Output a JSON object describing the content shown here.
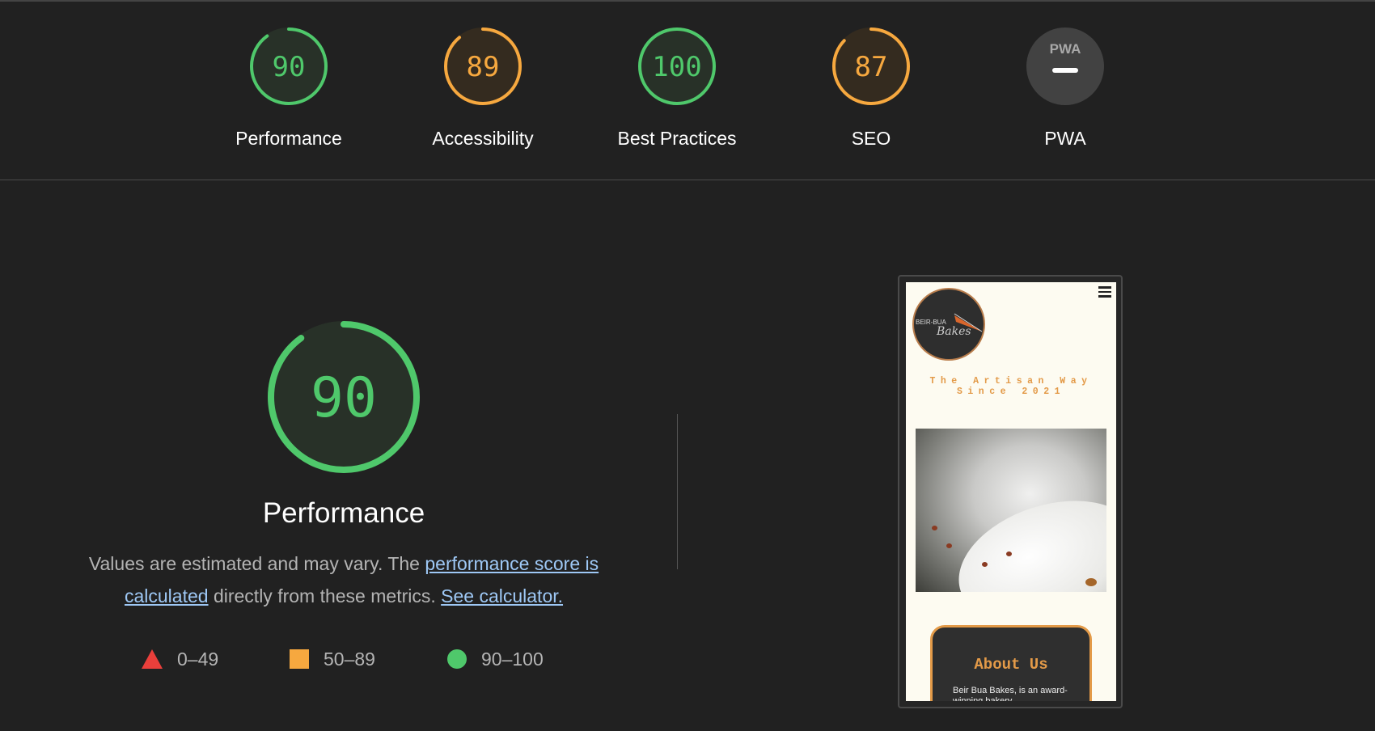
{
  "colors": {
    "background": "#212121",
    "pass": "#4fc86b",
    "average": "#f6a83f",
    "fail": "#ea3f3b",
    "link": "#9ec8f5",
    "muted_text": "#b4b4b4"
  },
  "header": {
    "gauges": [
      {
        "label": "Performance",
        "score": "90",
        "fraction": 0.9,
        "status": "pass"
      },
      {
        "label": "Accessibility",
        "score": "89",
        "fraction": 0.89,
        "status": "average"
      },
      {
        "label": "Best Practices",
        "score": "100",
        "fraction": 1.0,
        "status": "pass"
      },
      {
        "label": "SEO",
        "score": "87",
        "fraction": 0.87,
        "status": "average"
      },
      {
        "label": "PWA",
        "badge_text": "PWA",
        "icon": "pwa-dash-icon",
        "status": "na"
      }
    ]
  },
  "performance": {
    "score": "90",
    "fraction": 0.9,
    "title": "Performance",
    "desc_before": "Values are estimated and may vary. The ",
    "desc_link": "performance score is calculated",
    "desc_middle": " directly from these metrics. ",
    "desc_calc_link": "See calculator.",
    "legend": [
      {
        "range": "0–49",
        "icon": "triangle-icon"
      },
      {
        "range": "50–89",
        "icon": "square-icon"
      },
      {
        "range": "90–100",
        "icon": "circle-icon"
      }
    ]
  },
  "thumbnail": {
    "logo_text": "BEIR-BUA",
    "logo_script": "Bakes",
    "tagline_line1": "The Artisan Way",
    "tagline_line2": "Since 2021",
    "about_title": "About Us",
    "about_text": "Beir Bua Bakes, is an award-winning bakery"
  }
}
